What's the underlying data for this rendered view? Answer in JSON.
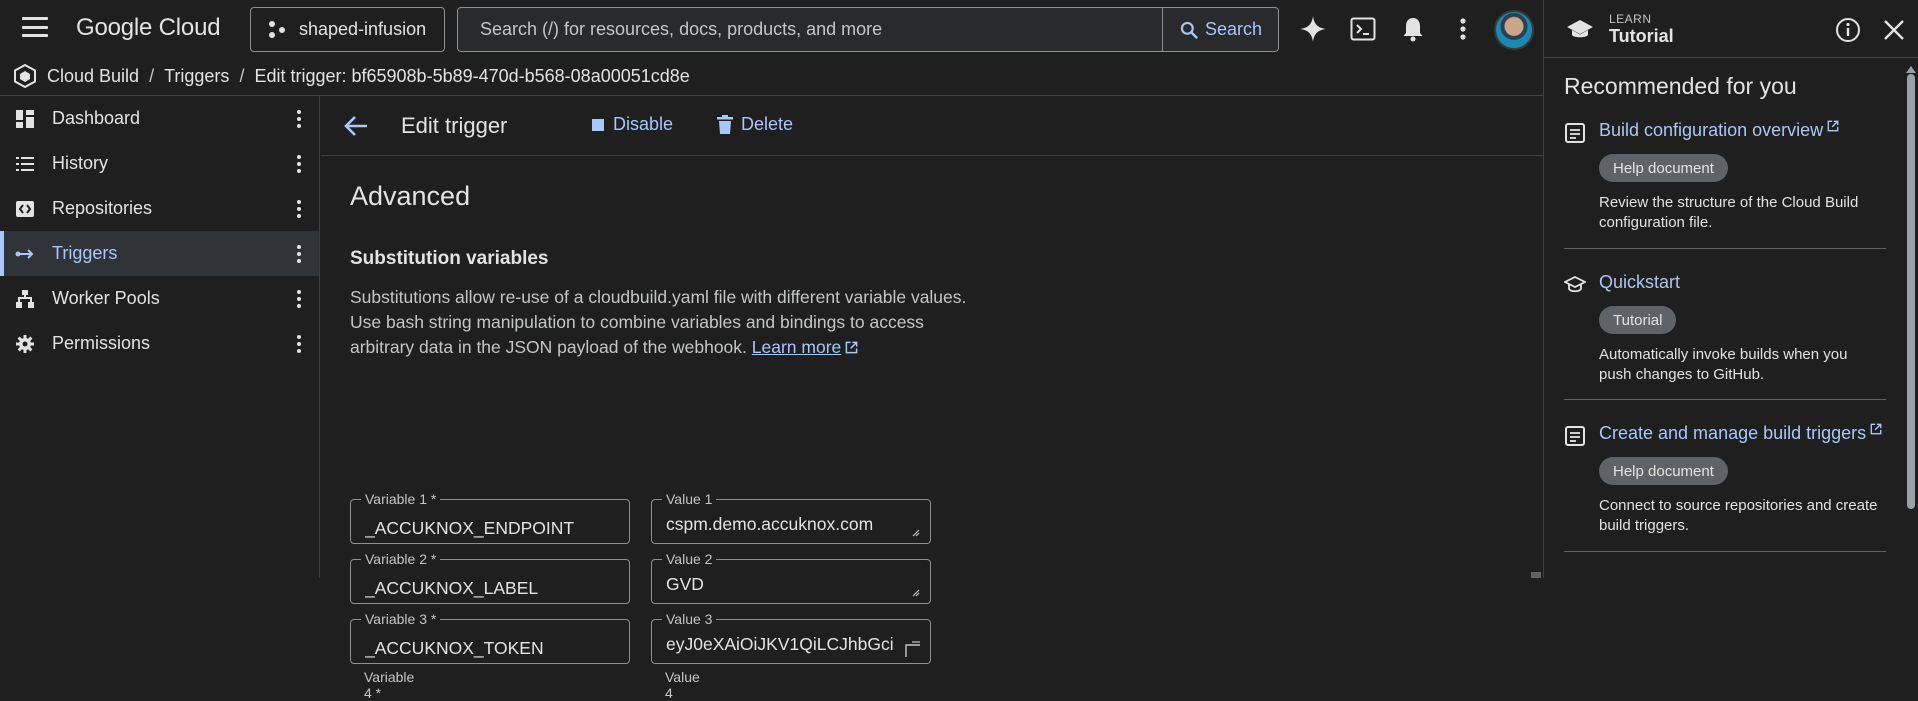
{
  "topbar": {
    "logo": "Google Cloud",
    "project": "shaped-infusion",
    "search_placeholder": "Search (/) for resources, docs, products, and more",
    "search_button": "Search"
  },
  "breadcrumb": {
    "product": "Cloud Build",
    "section": "Triggers",
    "current": "Edit trigger: bf65908b-5b89-470d-b568-08a00051cd8e"
  },
  "sidebar": {
    "items": [
      {
        "label": "Dashboard",
        "icon": "dashboard-icon"
      },
      {
        "label": "History",
        "icon": "list-icon"
      },
      {
        "label": "Repositories",
        "icon": "repository-icon"
      },
      {
        "label": "Triggers",
        "icon": "trigger-icon",
        "active": true
      },
      {
        "label": "Worker Pools",
        "icon": "worker-pools-icon"
      },
      {
        "label": "Permissions",
        "icon": "gear-icon"
      }
    ]
  },
  "header": {
    "title": "Edit trigger",
    "disable": "Disable",
    "delete": "Delete"
  },
  "content": {
    "advanced": "Advanced",
    "subs_title": "Substitution variables",
    "desc": "Substitutions allow re-use of a cloudbuild.yaml file with different variable values. Use bash string manipulation to combine variables and bindings to access arbitrary data in the JSON payload of the webhook.",
    "learn_more": "Learn more",
    "variables": [
      {
        "var_label": "Variable 1 *",
        "var_value": "_ACCUKNOX_ENDPOINT",
        "val_label": "Value 1",
        "val_value": "cspm.demo.accuknox.com"
      },
      {
        "var_label": "Variable 2 *",
        "var_value": "_ACCUKNOX_LABEL",
        "val_label": "Value 2",
        "val_value": "GVD"
      },
      {
        "var_label": "Variable 3 *",
        "var_value": "_ACCUKNOX_TOKEN",
        "val_label": "Value 3",
        "val_value": "eyJ0eXAiOiJKV1QiLCJhbGci"
      }
    ],
    "cut_var": "Variable 4 *",
    "cut_val": "Value 4"
  },
  "learn_panel": {
    "kicker": "LEARN",
    "title": "Tutorial",
    "heading": "Recommended for you",
    "cards": [
      {
        "title": "Build configuration overview",
        "badge": "Help document",
        "desc": "Review the structure of the Cloud Build configuration file.",
        "icon": "document-icon"
      },
      {
        "title": "Quickstart",
        "badge": "Tutorial",
        "desc": "Automatically invoke builds when you push changes to GitHub.",
        "icon": "school-icon"
      },
      {
        "title": "Create and manage build triggers",
        "badge": "Help document",
        "desc": "Connect to source repositories and create build triggers.",
        "icon": "document-icon"
      }
    ]
  },
  "colors": {
    "background": "#1f1f1f",
    "accent": "#a8c7fa",
    "text": "#e3e3e3",
    "border": "#8e918f"
  }
}
